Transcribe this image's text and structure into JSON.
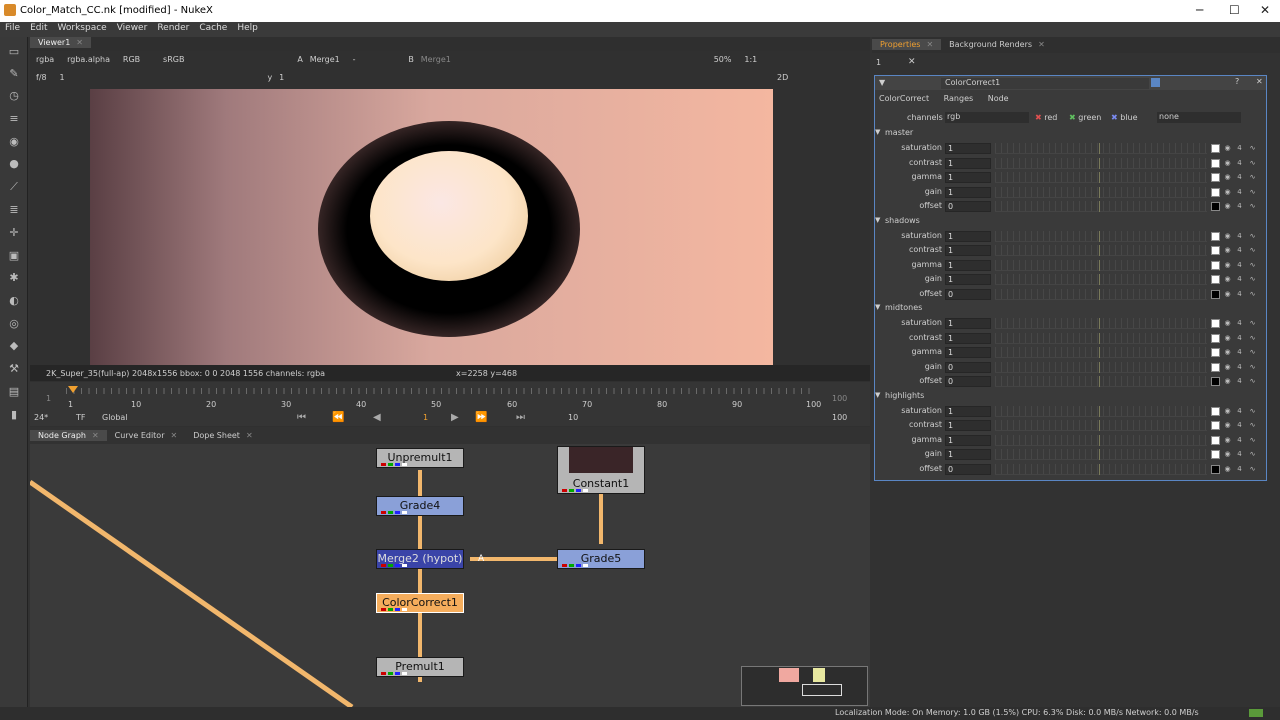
{
  "window": {
    "title": "Color_Match_CC.nk [modified] - NukeX",
    "minimize": "─",
    "maximize": "☐",
    "close": "✕"
  },
  "menu": [
    "File",
    "Edit",
    "Workspace",
    "Viewer",
    "Render",
    "Cache",
    "Help"
  ],
  "viewer": {
    "tab": "Viewer1",
    "channels": "rgba",
    "alpha": "rgba.alpha",
    "colorspace_display": "RGB",
    "lut": "sRGB",
    "input_a_label": "A",
    "input_a": "Merge1",
    "input_a_sel": "-",
    "input_b_label": "B",
    "input_b": "Merge1",
    "zoom": "50%",
    "ratio": "1:1",
    "view_mode": "2D",
    "fstop": "f/8",
    "frame_in": "1",
    "y_label": "y",
    "y_value": "1",
    "status": "2K_Super_35(full-ap) 2048x1556  bbox: 0 0 2048 1556 channels: rgba",
    "coords": "x=2258 y=468"
  },
  "timeline": {
    "ticks": [
      "1",
      "10",
      "20",
      "30",
      "40",
      "50",
      "60",
      "70",
      "80",
      "90",
      "100"
    ],
    "start": "1",
    "end": "100",
    "fps": "24*",
    "tf": "TF",
    "scope": "Global",
    "current": "1",
    "step": "10",
    "end_right": "100"
  },
  "nodegraph": {
    "tabs": [
      "Node Graph",
      "Curve Editor",
      "Dope Sheet"
    ],
    "nodes": [
      {
        "label": "Unpremult1"
      },
      {
        "label": "Grade4"
      },
      {
        "label": "Merge2 (hypot)"
      },
      {
        "label": "ColorCorrect1"
      },
      {
        "label": "Premult1"
      },
      {
        "label": "Constant1"
      },
      {
        "label": "Grade5"
      }
    ],
    "merge_input_label": "A"
  },
  "properties": {
    "tabs": [
      "Properties",
      "Background Renders"
    ],
    "counter": "1",
    "node_name": "ColorCorrect1",
    "subtabs": [
      "ColorCorrect",
      "Ranges",
      "Node"
    ],
    "channels_label": "channels",
    "channels_value": "rgb",
    "channel_toggles": [
      "red",
      "green",
      "blue"
    ],
    "channels_extra": "none",
    "sections": [
      {
        "name": "master",
        "rows": [
          {
            "label": "saturation",
            "value": "1"
          },
          {
            "label": "contrast",
            "value": "1"
          },
          {
            "label": "gamma",
            "value": "1"
          },
          {
            "label": "gain",
            "value": "1"
          },
          {
            "label": "offset",
            "value": "0"
          }
        ]
      },
      {
        "name": "shadows",
        "rows": [
          {
            "label": "saturation",
            "value": "1"
          },
          {
            "label": "contrast",
            "value": "1"
          },
          {
            "label": "gamma",
            "value": "1"
          },
          {
            "label": "gain",
            "value": "1"
          },
          {
            "label": "offset",
            "value": "0"
          }
        ]
      },
      {
        "name": "midtones",
        "rows": [
          {
            "label": "saturation",
            "value": "1"
          },
          {
            "label": "contrast",
            "value": "1"
          },
          {
            "label": "gamma",
            "value": "1"
          },
          {
            "label": "gain",
            "value": "0"
          },
          {
            "label": "offset",
            "value": "0"
          }
        ]
      },
      {
        "name": "highlights",
        "rows": [
          {
            "label": "saturation",
            "value": "1"
          },
          {
            "label": "contrast",
            "value": "1"
          },
          {
            "label": "gamma",
            "value": "1"
          },
          {
            "label": "gain",
            "value": "1"
          },
          {
            "label": "offset",
            "value": "0"
          }
        ]
      }
    ],
    "row_count_badge": "4"
  },
  "statusbar": {
    "text": "Localization Mode: On  Memory: 1.0 GB (1.5%)  CPU: 6.3%  Disk: 0.0 MB/s  Network: 0.0 MB/s"
  },
  "colors": {
    "pipe": "#f2b76c",
    "selected_node": "#f5ad5c",
    "grade_node": "#8aa0d8",
    "merge_node": "#3a44a8",
    "neutral_node": "#b5b5b5",
    "panel_border": "#5a86c4"
  }
}
